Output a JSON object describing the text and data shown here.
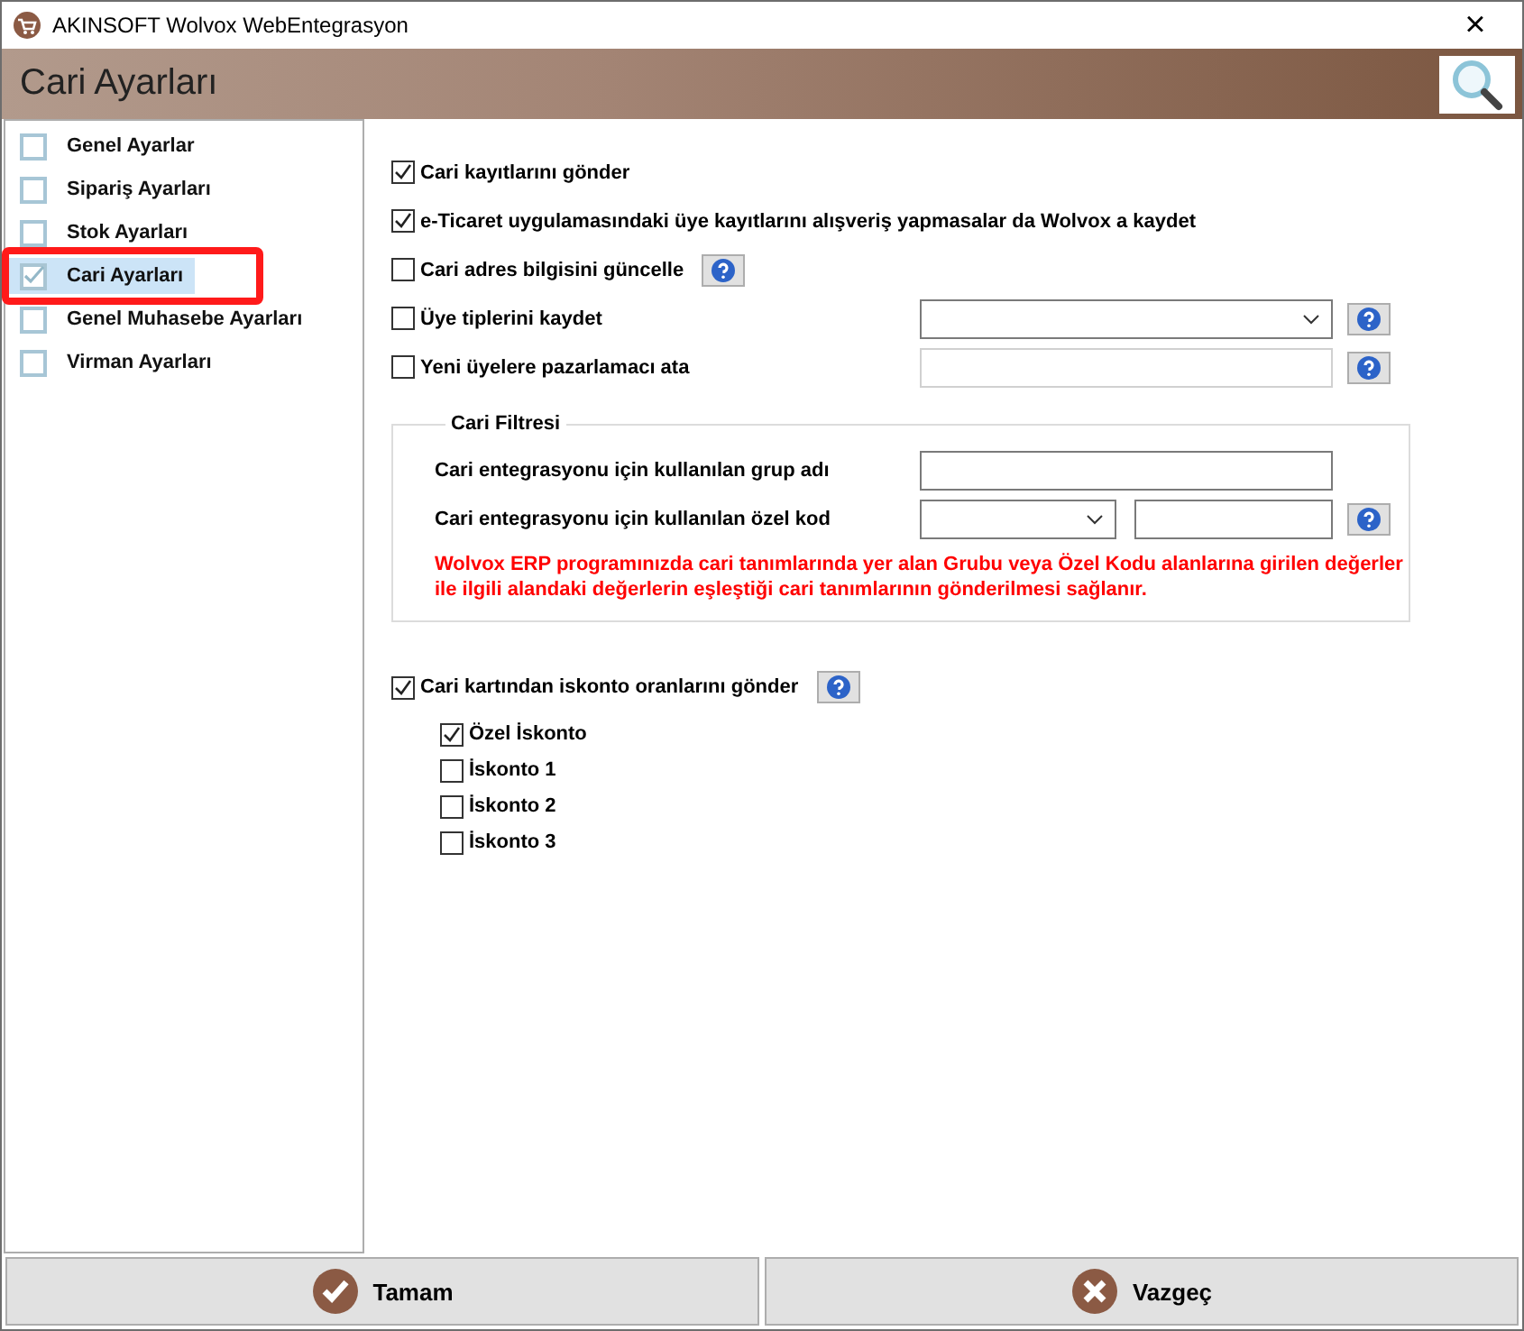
{
  "window": {
    "title": "AKINSOFT Wolvox WebEntegrasyon",
    "close": "×"
  },
  "header": {
    "title": "Cari Ayarları"
  },
  "sidebar": {
    "items": [
      {
        "label": "Genel Ayarlar",
        "selected": false,
        "highlighted": false
      },
      {
        "label": "Sipariş Ayarları",
        "selected": false,
        "highlighted": false
      },
      {
        "label": "Stok Ayarları",
        "selected": false,
        "highlighted": false
      },
      {
        "label": "Cari Ayarları",
        "selected": true,
        "highlighted": true
      },
      {
        "label": "Genel Muhasebe Ayarları",
        "selected": false,
        "highlighted": false
      },
      {
        "label": "Virman Ayarları",
        "selected": false,
        "highlighted": false
      }
    ]
  },
  "options": [
    {
      "label": "Cari kayıtlarını gönder",
      "checked": true,
      "kind": "plain"
    },
    {
      "label": "e-Ticaret uygulamasındaki üye kayıtlarını alışveriş yapmasalar da Wolvox a kaydet",
      "checked": true,
      "kind": "plain"
    },
    {
      "label": "Cari adres bilgisini güncelle",
      "checked": false,
      "kind": "help"
    },
    {
      "label": "Üye tiplerini kaydet",
      "checked": false,
      "kind": "dropdown"
    },
    {
      "label": "Yeni üyelere pazarlamacı ata",
      "checked": false,
      "kind": "field"
    }
  ],
  "filter": {
    "title": "Cari Filtresi",
    "rows": [
      {
        "label": "Cari entegrasyonu için kullanılan grup adı",
        "kind": "field"
      },
      {
        "label": "Cari entegrasyonu için kullanılan özel kod",
        "kind": "dropdown-field"
      }
    ],
    "note": "Wolvox ERP programınızda cari tanımlarında yer alan Grubu veya Özel Kodu alanlarına girilen değerler ile ilgili alandaki değerlerin eşleştiği cari tanımlarının gönderilmesi sağlanır."
  },
  "discount": {
    "label": "Cari kartından iskonto oranlarını gönder",
    "checked": true,
    "items": [
      {
        "label": "Özel İskonto",
        "checked": true
      },
      {
        "label": "İskonto 1",
        "checked": false
      },
      {
        "label": "İskonto 2",
        "checked": false
      },
      {
        "label": "İskonto 3",
        "checked": false
      }
    ]
  },
  "buttons": [
    {
      "label": "Tamam",
      "kind": "ok"
    },
    {
      "label": "Vazgeç",
      "kind": "cancel"
    }
  ]
}
